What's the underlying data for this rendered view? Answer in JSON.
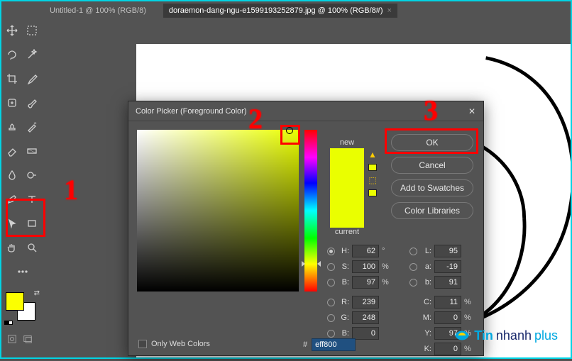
{
  "tabs": {
    "items": [
      {
        "label": "Untitled-1 @ 100% (RGB/8)",
        "active": false
      },
      {
        "label": "doraemon-dang-ngu-e1599193252879.jpg @ 100% (RGB/8#)",
        "active": true
      }
    ]
  },
  "dialog": {
    "title": "Color Picker (Foreground Color)",
    "ok": "OK",
    "cancel": "Cancel",
    "add_swatch": "Add to Swatches",
    "libraries": "Color Libraries",
    "new_label": "new",
    "current_label": "current",
    "only_web": "Only Web Colors",
    "hex_prefix": "#",
    "hex_value": "eff800",
    "hsb": {
      "h": "62",
      "s": "100",
      "b": "97",
      "deg": "°",
      "pct": "%"
    },
    "lab": {
      "l": "95",
      "a": "-19",
      "b": "91"
    },
    "rgb": {
      "r": "239",
      "g": "248",
      "b": "0"
    },
    "cmyk": {
      "c": "11",
      "m": "0",
      "y": "97",
      "k": "0",
      "pct": "%"
    },
    "labels": {
      "H": "H:",
      "S": "S:",
      "B": "B:",
      "L": "L:",
      "a": "a:",
      "b": "b:",
      "R": "R:",
      "G": "G:",
      "Bc": "B:",
      "C": "C:",
      "M": "M:",
      "Y": "Y:",
      "K": "K:"
    }
  },
  "colors": {
    "foreground": "#fcff00",
    "background": "#ffffff",
    "selected": "#eaff00"
  },
  "annotations": {
    "n1": "1",
    "n2": "2",
    "n3": "3"
  },
  "watermark": {
    "a": "Tin",
    "b": "nhanh",
    "c": "plus"
  }
}
